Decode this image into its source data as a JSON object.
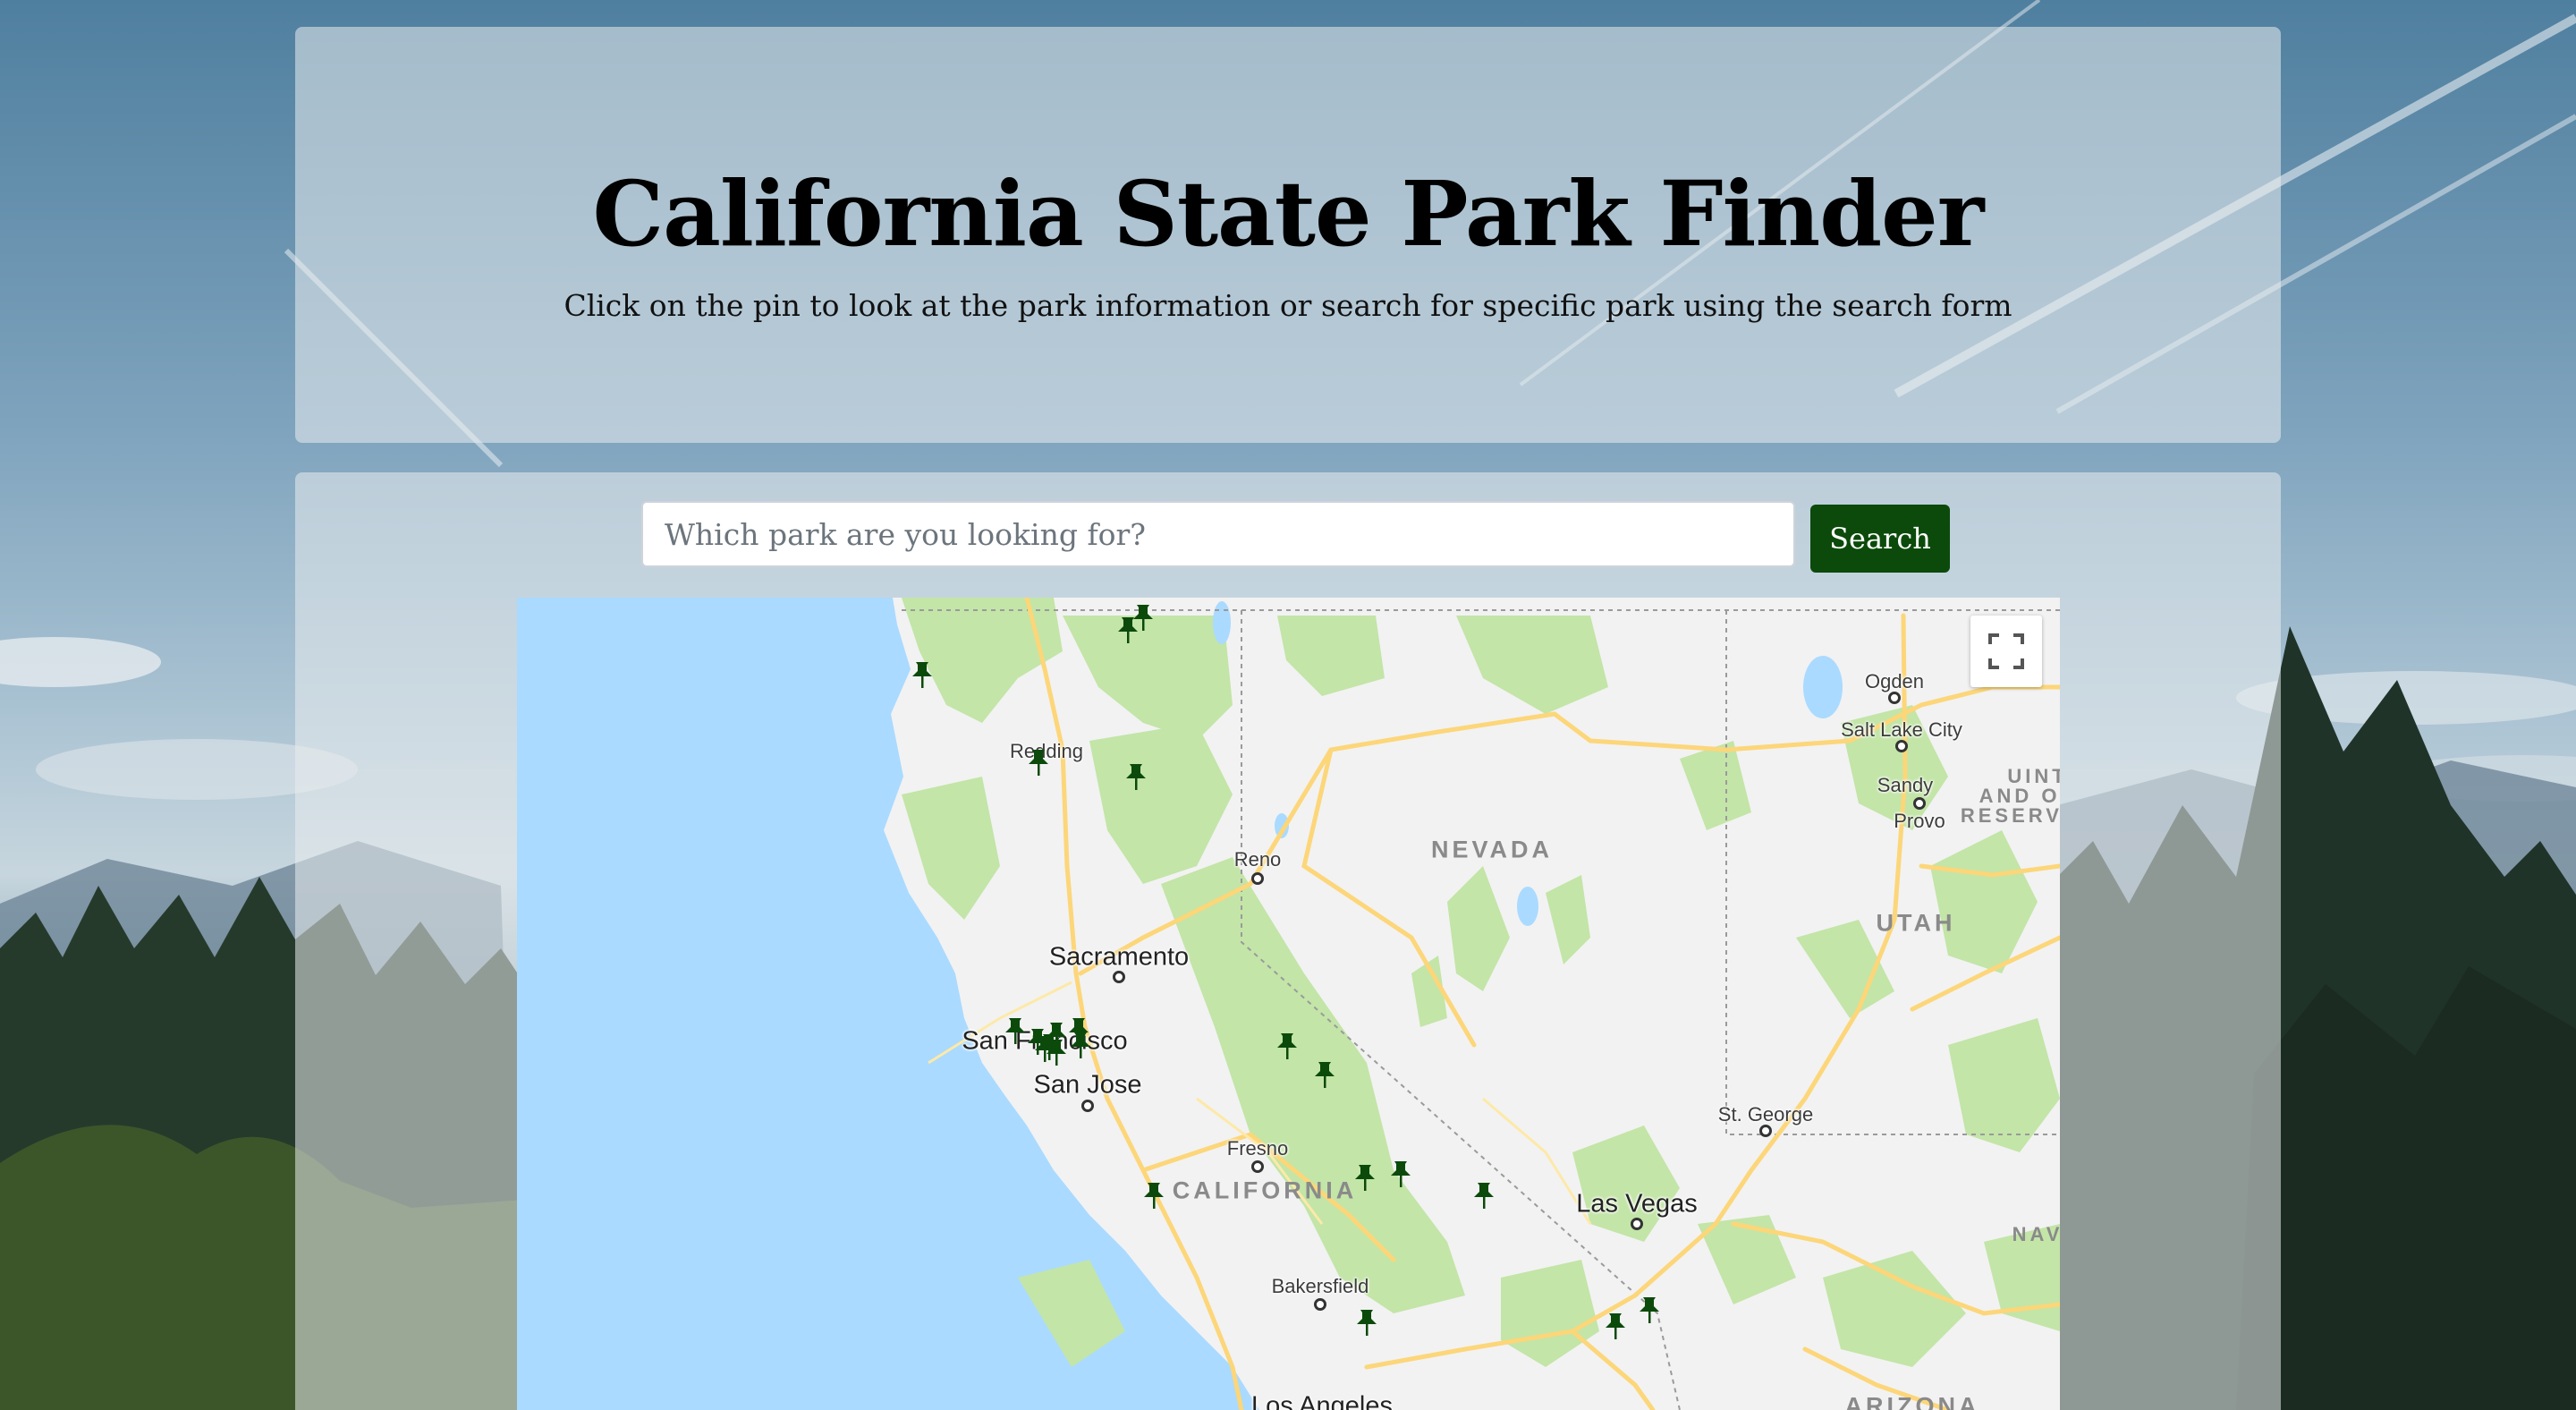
{
  "header": {
    "title": "California State Park Finder",
    "subtitle": "Click on the pin to look at the park information or search for specific park using the search form"
  },
  "search": {
    "placeholder": "Which park are you looking for?",
    "value": "",
    "button_label": "Search"
  },
  "map": {
    "cities": {
      "ogden": "Ogden",
      "salt_lake_city": "Salt Lake City",
      "sandy": "Sandy",
      "provo": "Provo",
      "redding": "Redding",
      "reno": "Reno",
      "sacramento": "Sacramento",
      "san_francisco": "San Francisco",
      "san_jose": "San Jose",
      "fresno": "Fresno",
      "bakersfield": "Bakersfield",
      "las_vegas": "Las Vegas",
      "st_george": "St. George",
      "los_angeles": "Los Angeles"
    },
    "regions": {
      "nevada": "NEVADA",
      "utah": "UTAH",
      "california": "CALIFORNIA",
      "arizona": "ARIZONA",
      "uintah_1": "UINT",
      "uintah_2": "AND OU",
      "uintah_3": "RESERVA",
      "navajo": "NAV"
    },
    "pin_icon": "thumbtack-icon",
    "pin_color": "#0b4a0b",
    "fullscreen_icon": "fullscreen-icon"
  },
  "colors": {
    "accent": "#0b4a0b",
    "water": "#aadaff",
    "park_green": "#c3e5a8",
    "road": "#fcd679"
  }
}
